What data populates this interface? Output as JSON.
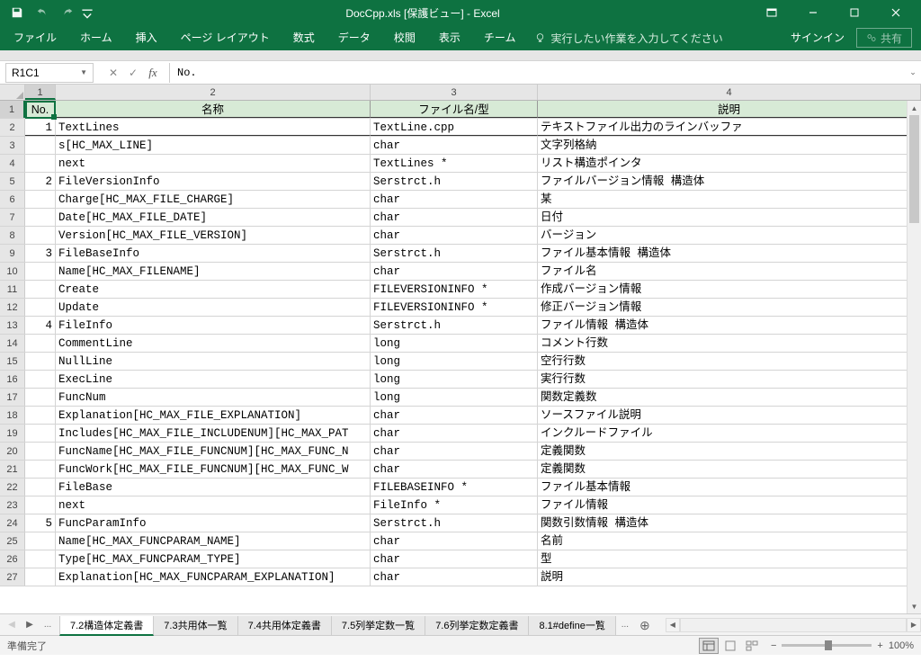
{
  "title": "DocCpp.xls [保護ビュー] - Excel",
  "ribbon": {
    "tabs": [
      "ファイル",
      "ホーム",
      "挿入",
      "ページ レイアウト",
      "数式",
      "データ",
      "校閲",
      "表示",
      "チーム"
    ],
    "tellme": "実行したい作業を入力してください",
    "signin": "サインイン",
    "share": "共有"
  },
  "namebox": "R1C1",
  "formula": "No.",
  "colLabels": [
    "1",
    "2",
    "3",
    "4"
  ],
  "headers": {
    "c1": "No.",
    "c2": "名称",
    "c3": "ファイル名/型",
    "c4": "説明"
  },
  "rows": [
    {
      "n": "1",
      "c2": "TextLines",
      "c3": "TextLine.cpp",
      "c4": "テキストファイル出力のラインバッファ"
    },
    {
      "n": "",
      "c2": "s[HC_MAX_LINE]",
      "c3": "char",
      "c4": "文字列格納"
    },
    {
      "n": "",
      "c2": "next",
      "c3": "TextLines *",
      "c4": "リスト構造ポインタ"
    },
    {
      "n": "2",
      "c2": "FileVersionInfo",
      "c3": "Serstrct.h",
      "c4": "ファイルバージョン情報 構造体"
    },
    {
      "n": "",
      "c2": "Charge[HC_MAX_FILE_CHARGE]",
      "c3": "char",
      "c4": "某"
    },
    {
      "n": "",
      "c2": "Date[HC_MAX_FILE_DATE]",
      "c3": "char",
      "c4": "日付"
    },
    {
      "n": "",
      "c2": "Version[HC_MAX_FILE_VERSION]",
      "c3": "char",
      "c4": "バージョン"
    },
    {
      "n": "3",
      "c2": "FileBaseInfo",
      "c3": "Serstrct.h",
      "c4": "ファイル基本情報 構造体"
    },
    {
      "n": "",
      "c2": "Name[HC_MAX_FILENAME]",
      "c3": "char",
      "c4": "ファイル名"
    },
    {
      "n": "",
      "c2": "Create",
      "c3": "FILEVERSIONINFO *",
      "c4": "作成バージョン情報"
    },
    {
      "n": "",
      "c2": "Update",
      "c3": "FILEVERSIONINFO *",
      "c4": "修正バージョン情報"
    },
    {
      "n": "4",
      "c2": "FileInfo",
      "c3": "Serstrct.h",
      "c4": "ファイル情報 構造体"
    },
    {
      "n": "",
      "c2": "CommentLine",
      "c3": "long",
      "c4": "コメント行数"
    },
    {
      "n": "",
      "c2": "NullLine",
      "c3": "long",
      "c4": "空行行数"
    },
    {
      "n": "",
      "c2": "ExecLine",
      "c3": "long",
      "c4": "実行行数"
    },
    {
      "n": "",
      "c2": "FuncNum",
      "c3": "long",
      "c4": "関数定義数"
    },
    {
      "n": "",
      "c2": "Explanation[HC_MAX_FILE_EXPLANATION]",
      "c3": "char",
      "c4": "ソースファイル説明"
    },
    {
      "n": "",
      "c2": "Includes[HC_MAX_FILE_INCLUDENUM][HC_MAX_PAT",
      "c3": "char",
      "c4": "インクルードファイル"
    },
    {
      "n": "",
      "c2": "FuncName[HC_MAX_FILE_FUNCNUM][HC_MAX_FUNC_N",
      "c3": "char",
      "c4": "定義関数"
    },
    {
      "n": "",
      "c2": "FuncWork[HC_MAX_FILE_FUNCNUM][HC_MAX_FUNC_W",
      "c3": "char",
      "c4": "定義関数"
    },
    {
      "n": "",
      "c2": "FileBase",
      "c3": "FILEBASEINFO *",
      "c4": "ファイル基本情報"
    },
    {
      "n": "",
      "c2": "next",
      "c3": "FileInfo *",
      "c4": "ファイル情報"
    },
    {
      "n": "5",
      "c2": "FuncParamInfo",
      "c3": "Serstrct.h",
      "c4": "関数引数情報 構造体"
    },
    {
      "n": "",
      "c2": "Name[HC_MAX_FUNCPARAM_NAME]",
      "c3": "char",
      "c4": "名前"
    },
    {
      "n": "",
      "c2": "Type[HC_MAX_FUNCPARAM_TYPE]",
      "c3": "char",
      "c4": "型"
    },
    {
      "n": "",
      "c2": "Explanation[HC_MAX_FUNCPARAM_EXPLANATION]",
      "c3": "char",
      "c4": "説明"
    }
  ],
  "sheets": {
    "ellipsis": "...",
    "tabs": [
      "7.2構造体定義書",
      "7.3共用体一覧",
      "7.4共用体定義書",
      "7.5列挙定数一覧",
      "7.6列挙定数定義書",
      "8.1#define一覧"
    ],
    "active": 0
  },
  "status": {
    "ready": "準備完了",
    "zoom": "100%"
  }
}
